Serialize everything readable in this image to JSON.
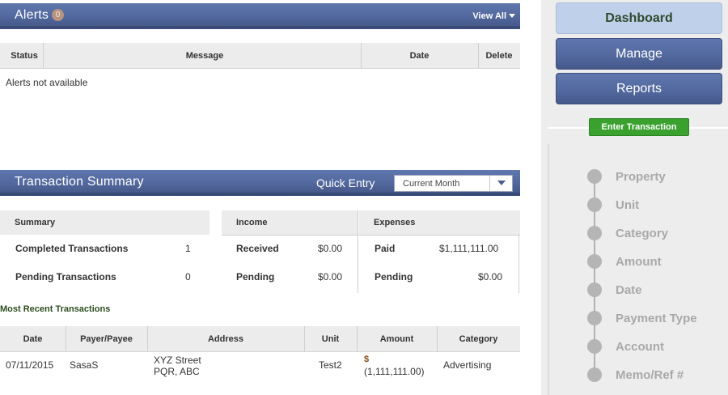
{
  "alerts": {
    "title": "Alerts",
    "count": "0",
    "view_all": "View All",
    "columns": [
      "Status",
      "Message",
      "Date",
      "Delete"
    ],
    "empty_text": "Alerts not available"
  },
  "summary": {
    "title": "Transaction Summary",
    "quick_entry_label": "Quick Entry",
    "period_selected": "Current Month",
    "summary_header": "Summary",
    "income_header": "Income",
    "expenses_header": "Expenses",
    "completed_label": "Completed Transactions",
    "completed_count": "1",
    "pending_label": "Pending Transactions",
    "pending_count": "0",
    "received_label": "Received",
    "received_value": "$0.00",
    "income_pending_label": "Pending",
    "income_pending_value": "$0.00",
    "paid_label": "Paid",
    "paid_value": "$1,111,111.00",
    "expense_pending_label": "Pending",
    "expense_pending_value": "$0.00"
  },
  "recent": {
    "title": "Most Recent Transactions",
    "columns": [
      "Date",
      "Payer/Payee",
      "Address",
      "Unit",
      "Amount",
      "Category"
    ],
    "rows": [
      {
        "date": "07/11/2015",
        "payee": "SasaS",
        "address_line1": "XYZ Street",
        "address_line2": "PQR, ABC",
        "unit": "Test2",
        "amount_symbol": "$",
        "amount_value": "(1,111,111.00)",
        "category": "Advertising"
      }
    ]
  },
  "sidebar": {
    "dashboard": "Dashboard",
    "manage": "Manage",
    "reports": "Reports",
    "enter_transaction": "Enter Transaction",
    "steps": [
      "Property",
      "Unit",
      "Category",
      "Amount",
      "Date",
      "Payment Type",
      "Account",
      "Memo/Ref #"
    ]
  },
  "colors": {
    "header_blue": "#53699f",
    "dashboard_active": "#bfd1ea",
    "enter_green": "#3aa12e",
    "recent_title_green": "#2e4e1e"
  }
}
